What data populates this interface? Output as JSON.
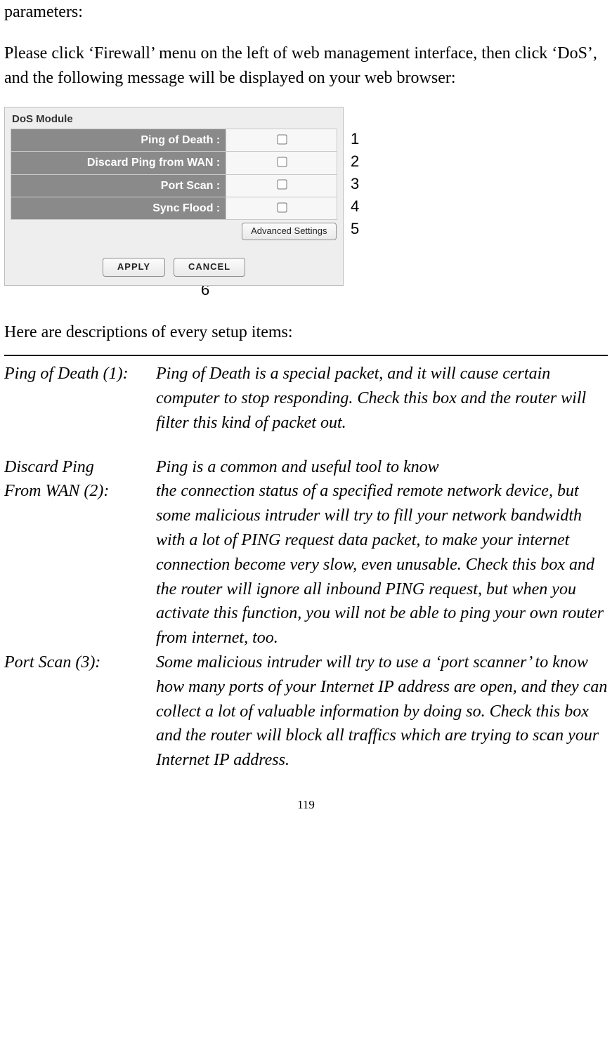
{
  "intro_fragment": "parameters:",
  "instructions": "Please click ‘Firewall’ menu on the left of web management interface, then click ‘DoS’, and the following message will be displayed on your web browser:",
  "dos_module": {
    "title": "DoS Module",
    "rows": [
      {
        "label": "Ping of Death :"
      },
      {
        "label": "Discard Ping from WAN :"
      },
      {
        "label": "Port Scan :"
      },
      {
        "label": "Sync Flood :"
      }
    ],
    "advanced_btn": "Advanced Settings",
    "apply_btn": "APPLY",
    "cancel_btn": "CANCEL"
  },
  "annotations": {
    "a1": "1",
    "a2": "2",
    "a3": "3",
    "a4": "4",
    "a5": "5",
    "a6": "6"
  },
  "desc_heading": "Here are descriptions of every setup items:",
  "items": {
    "ping_of_death": {
      "name": "Ping of Death (1):",
      "desc": "Ping of Death is a special packet, and it will cause certain computer to stop responding. Check this box and the router will filter this kind of packet out."
    },
    "discard_ping": {
      "name_l1": "Discard Ping",
      "name_l2": "From WAN (2):",
      "desc_l1": "Ping is a common and useful tool to know",
      "desc_rest": "the connection status of a specified remote network device, but some malicious intruder will try to fill your network bandwidth with a lot of PING request data packet, to make your internet connection become very slow, even unusable. Check this box and the router will ignore all inbound PING request, but when you activate this function, you will not be able to ping your own router from internet, too."
    },
    "port_scan": {
      "name": "Port Scan (3):",
      "desc": "Some malicious intruder will try to use a ‘port scanner’ to know how many ports of your Internet IP address are open, and they can collect a lot of valuable information by doing so. Check this box and the router will block all traffics which are trying to scan your Internet IP address."
    }
  },
  "page_number": "119"
}
